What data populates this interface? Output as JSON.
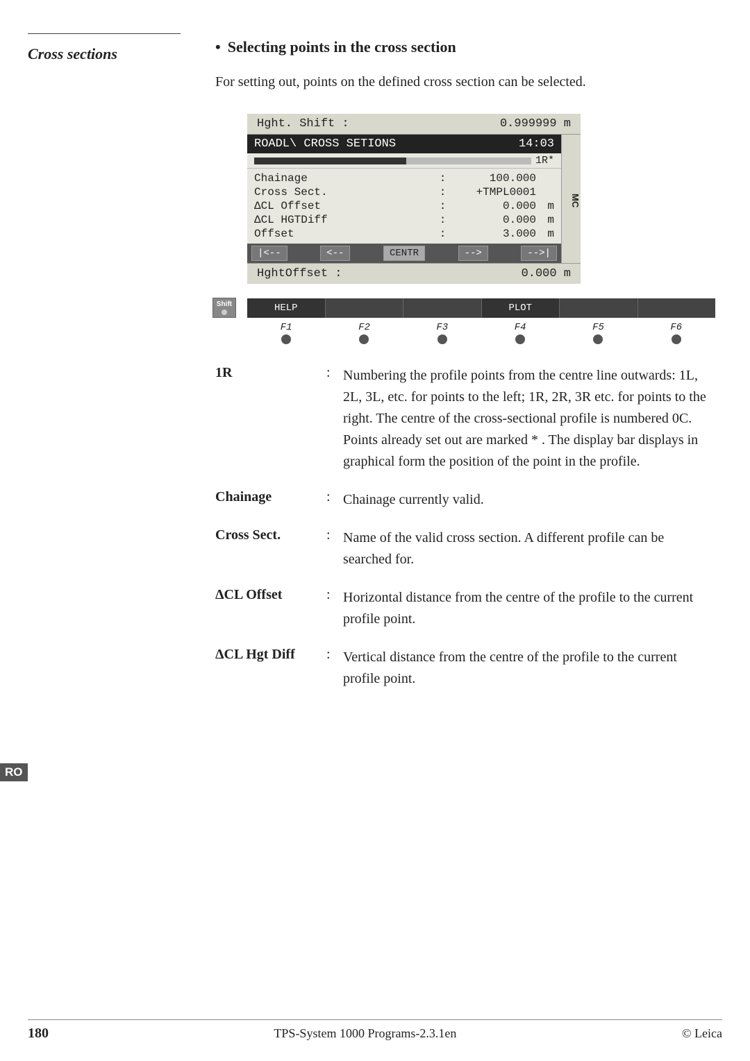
{
  "sidebar": {
    "label": "Cross sections",
    "ro_badge": "RO"
  },
  "section": {
    "title": "Selecting points in the cross section",
    "intro": "For setting out, points on the defined cross section can be selected."
  },
  "device": {
    "hght_shift_label": "Hght. Shift :",
    "hght_shift_value": "0.999999",
    "hght_shift_unit": "m",
    "header_title": "ROADL\\  CROSS SETIONS",
    "header_time": "14:03",
    "progress_label": "1R*",
    "mc_label": "MC",
    "fields": [
      {
        "label": "Chainage",
        "colon": ":",
        "value": "100.000",
        "unit": ""
      },
      {
        "label": "Cross Sect.",
        "colon": ":",
        "value": "+TMPL0001",
        "unit": ""
      },
      {
        "label": "ΔCL Offset",
        "colon": ":",
        "value": "0.000",
        "unit": "m"
      },
      {
        "label": "ΔCL HGTDiff",
        "colon": ":",
        "value": "0.000",
        "unit": "m"
      },
      {
        "label": "Offset",
        "colon": ":",
        "value": "3.000",
        "unit": "m"
      }
    ],
    "nav_buttons": [
      "|<--",
      "<--",
      "CENTR",
      "-->",
      "-->|"
    ],
    "hghtoffset_label": "HghtOffset  :",
    "hghtoffset_value": "0.000",
    "hghtoffset_unit": "m",
    "shift_key": "Shift",
    "func_buttons": [
      "HELP",
      "",
      "",
      "PLOT",
      "",
      ""
    ],
    "fkeys": [
      "F1",
      "F2",
      "F3",
      "F4",
      "F5",
      "F6"
    ]
  },
  "descriptions": [
    {
      "term": "1R",
      "colon": ":",
      "definition": "Numbering the profile points from the centre line outwards: 1L, 2L, 3L, etc. for points to the left; 1R, 2R, 3R etc. for points to the right. The centre of the cross-sectional profile is numbered 0C. Points already set out are marked * . The display bar displays in graphical form the position of the point in the profile."
    },
    {
      "term": "Chainage",
      "colon": ":",
      "definition": "Chainage currently valid."
    },
    {
      "term": "Cross Sect.",
      "colon": ":",
      "definition": "Name of the valid cross section. A different profile can be searched for."
    },
    {
      "term": "ΔCL Offset",
      "colon": ":",
      "definition": "Horizontal distance from the centre of the profile to the current profile point."
    },
    {
      "term": "ΔCL Hgt Diff",
      "colon": ":",
      "definition": "Vertical distance from the centre of the profile to the current profile point."
    }
  ],
  "footer": {
    "page": "180",
    "center": "TPS-System 1000 Programs-2.3.1en",
    "right": "© Leica"
  }
}
